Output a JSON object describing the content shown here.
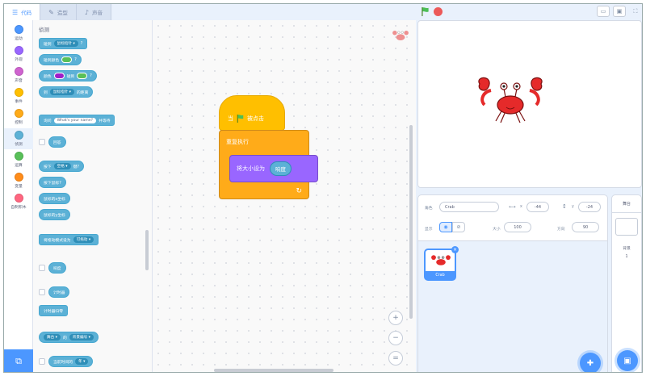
{
  "tabs": [
    {
      "label": "代码",
      "icon": "code-icon",
      "active": true
    },
    {
      "label": "造型",
      "icon": "brush-icon",
      "active": false
    },
    {
      "label": "声音",
      "icon": "sound-icon",
      "active": false
    }
  ],
  "categories": [
    {
      "label": "运动",
      "color": "#4c97ff"
    },
    {
      "label": "外观",
      "color": "#9966ff"
    },
    {
      "label": "声音",
      "color": "#cf63cf"
    },
    {
      "label": "事件",
      "color": "#ffbf00"
    },
    {
      "label": "控制",
      "color": "#ffab19"
    },
    {
      "label": "侦测",
      "color": "#5cb1d6"
    },
    {
      "label": "运算",
      "color": "#59c059"
    },
    {
      "label": "变量",
      "color": "#ff8c1a"
    },
    {
      "label": "自制积木",
      "color": "#ff6680"
    }
  ],
  "palette": {
    "title": "侦测",
    "touching": {
      "label": "碰到",
      "value": "鼠标指针"
    },
    "touching_color": {
      "label": "碰到颜色",
      "suffix": "?"
    },
    "color_touching": {
      "label1": "颜色",
      "label2": "碰到",
      "suffix": "?"
    },
    "distance": {
      "label": "到",
      "value": "鼠标指针",
      "suffix": "的距离"
    },
    "ask": {
      "label": "询问",
      "value": "What's your name?",
      "suffix": "并等待"
    },
    "answer": "回答",
    "key_pressed": {
      "label": "按下",
      "value": "空格",
      "suffix": "键?"
    },
    "mouse_down": "按下鼠标?",
    "mouse_x": "鼠标的x坐标",
    "mouse_y": "鼠标的y坐标",
    "drag_mode": {
      "label": "将拖动模式设为",
      "value": "可拖动"
    },
    "loudness": "响度",
    "timer": "计时器",
    "reset_timer": "计时器归零",
    "of": {
      "value1": "舞台",
      "label": "的",
      "value2": "背景编号"
    },
    "current": {
      "label": "当前时间的",
      "value": "年"
    }
  },
  "script": {
    "hat_label_1": "当",
    "hat_label_2": "被点击",
    "forever_label": "重复执行",
    "set_size_label": "将大小设为",
    "set_size_value": "响度"
  },
  "sprite_info": {
    "sprite_label": "角色",
    "sprite_name": "Crab",
    "x_label": "x",
    "x_value": "-44",
    "y_label": "y",
    "y_value": "-24",
    "show_label": "显示",
    "size_label": "大小",
    "size_value": "100",
    "direction_label": "方向",
    "direction_value": "90"
  },
  "sprite_list": [
    {
      "name": "Crab",
      "selected": true
    }
  ],
  "stage_panel": {
    "title": "舞台",
    "backdrop_label": "背景",
    "backdrop_count": "1"
  },
  "colors": {
    "accent": "#4c97ff",
    "sensing": "#5cb1d6",
    "events": "#ffbf00",
    "control": "#ffab19",
    "looks": "#9966ff",
    "crab": "#e52a2a"
  }
}
